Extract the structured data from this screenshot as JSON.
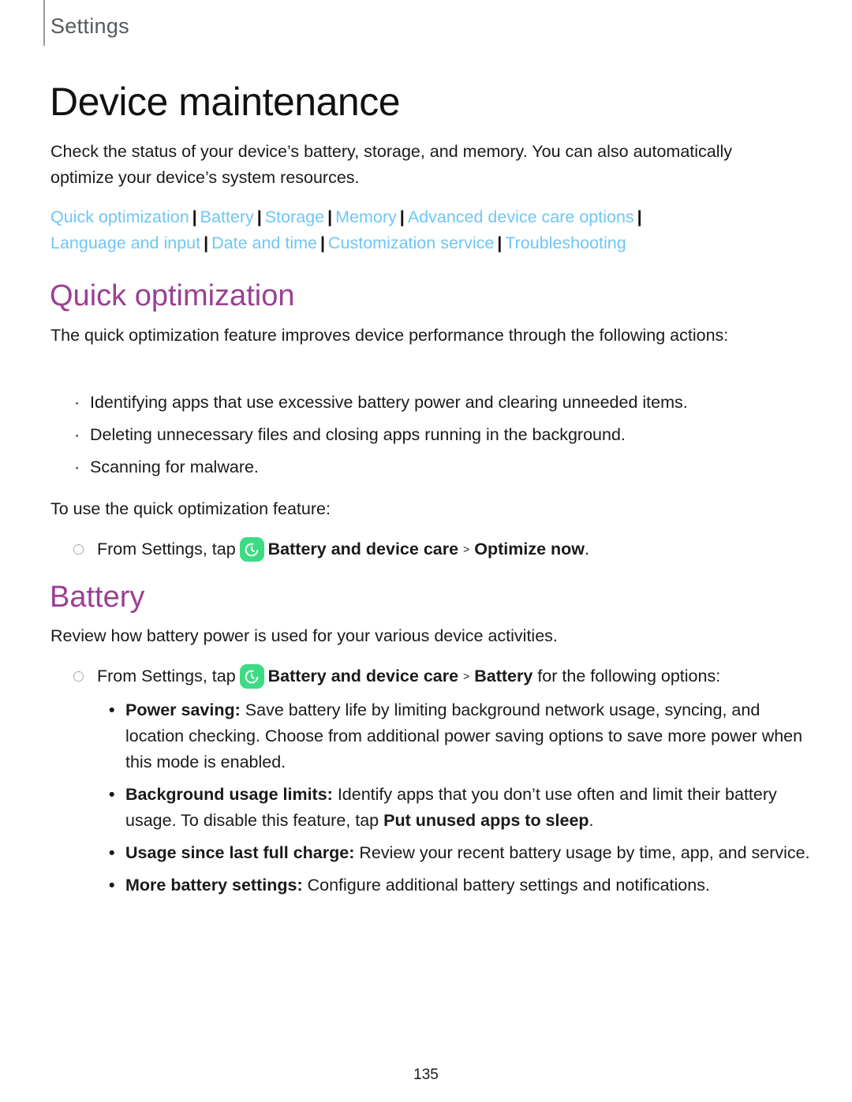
{
  "header": {
    "label": "Settings"
  },
  "page_title": "Device maintenance",
  "intro": "Check the status of your device’s battery, storage, and memory. You can also automatically optimize your device’s system resources.",
  "nav_links": [
    "Quick optimization",
    "Battery",
    "Storage",
    "Memory",
    "Advanced device care options",
    "Language and input",
    "Date and time",
    "Customization service",
    "Troubleshooting"
  ],
  "nav_separator": "|",
  "colors": {
    "link": "#6fc6f3",
    "heading": "#9b3f93",
    "app_icon": "#3ddc84"
  },
  "quick": {
    "heading": "Quick optimization",
    "description": "The quick optimization feature improves device performance through the following actions:",
    "bullets": [
      "Identifying apps that use excessive battery power and clearing unneeded items.",
      "Deleting unnecessary files and closing apps running in the background.",
      "Scanning for malware."
    ],
    "to_use": "To use the quick optimization feature:",
    "step": {
      "prefix": "From Settings, tap",
      "icon": "device-care-icon",
      "app": "Battery and device care",
      "arrow": ">",
      "target": "Optimize now",
      "suffix": "."
    }
  },
  "battery": {
    "heading": "Battery",
    "description": "Review how battery power is used for your various device activities.",
    "step": {
      "prefix": "From Settings, tap",
      "icon": "device-care-icon",
      "app": "Battery and device care",
      "arrow": ">",
      "target": "Battery",
      "suffix": "for the following options:"
    },
    "options": [
      {
        "term": "Power saving",
        "text": "Save battery life by limiting background network usage, syncing, and location checking. Choose from additional power saving options to save more power when this mode is enabled."
      },
      {
        "term": "Background usage limits",
        "text": "Identify apps that you don’t use often and limit their battery usage. To disable this feature, tap",
        "bold_tail": "Put unused apps to sleep",
        "tail_end": "."
      },
      {
        "term": "Usage since last full charge",
        "text": "Review your recent battery usage by time, app, and service."
      },
      {
        "term": "More battery settings",
        "text": "Configure additional battery settings and notifications."
      }
    ]
  },
  "bullet_glyph": "·",
  "option_bullet_glyph": "•",
  "page_number": "135"
}
